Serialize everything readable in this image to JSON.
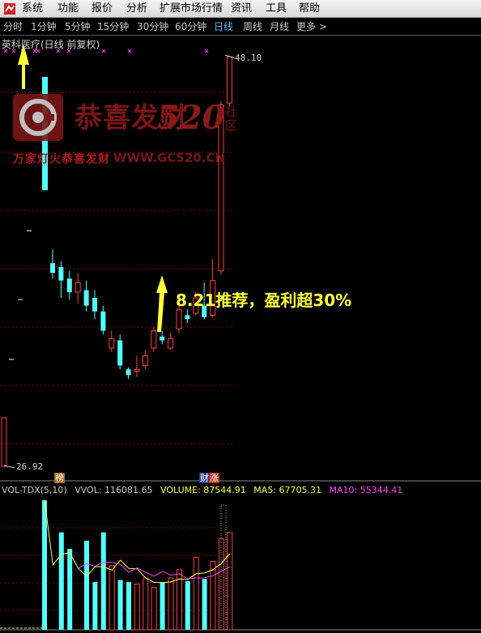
{
  "menu": {
    "items": [
      "系统",
      "功能",
      "报价",
      "分析",
      "扩展市场行情",
      "资讯",
      "工具",
      "帮助"
    ]
  },
  "periods": {
    "items": [
      "分时",
      "1分钟",
      "5分钟",
      "15分钟",
      "30分钟",
      "60分钟",
      "日线",
      "周线",
      "月线",
      "更多 >"
    ],
    "active": "日线"
  },
  "chart_title": "英科医疗(日线 前复权)",
  "price_high_label": "48.10",
  "price_low_label": "26.92",
  "annotation": "8.21推荐，盈利超30%",
  "tags": {
    "bang": "榜",
    "cai": "财",
    "zhang": "涨"
  },
  "watermark": {
    "brand": "恭喜发财",
    "number": "520",
    "she_qu": "社区",
    "slogan": "万家灯火恭喜发财",
    "url": "WWW.GC520.CN"
  },
  "volume_header": {
    "indicator": "VOL-TDX(5,10)",
    "vvol": "VVOL: 116081.65",
    "volume": "VOLUME: 87544.91",
    "ma5": "MA5: 67705.31",
    "ma10": "MA10: 55344.41"
  },
  "colors": {
    "up": "#ff4040",
    "down": "#54ffff",
    "ma5": "#ffff40",
    "ma10": "#ff40ff",
    "grid": "#8b0000",
    "annotation": "#ffff3c"
  },
  "chart_data": {
    "type": "candlestick",
    "price_range": [
      26.92,
      48.1
    ],
    "candles": [
      {
        "open": 37.4,
        "close": 36.9,
        "high": 38.1,
        "low": 36.6,
        "dir": "down"
      },
      {
        "open": 37.2,
        "close": 36.5,
        "high": 37.5,
        "low": 35.6,
        "dir": "down"
      },
      {
        "open": 36.6,
        "close": 35.9,
        "high": 37.0,
        "low": 35.5,
        "dir": "down"
      },
      {
        "open": 35.9,
        "close": 36.4,
        "high": 36.9,
        "low": 35.3,
        "dir": "up"
      },
      {
        "open": 36.0,
        "close": 35.2,
        "high": 36.5,
        "low": 34.9,
        "dir": "down"
      },
      {
        "open": 35.6,
        "close": 34.9,
        "high": 36.0,
        "low": 34.5,
        "dir": "down"
      },
      {
        "open": 34.9,
        "close": 33.9,
        "high": 35.2,
        "low": 33.7,
        "dir": "down"
      },
      {
        "open": 33.0,
        "close": 33.5,
        "high": 33.9,
        "low": 32.8,
        "dir": "up"
      },
      {
        "open": 33.4,
        "close": 32.1,
        "high": 33.7,
        "low": 31.9,
        "dir": "down"
      },
      {
        "open": 31.9,
        "close": 31.6,
        "high": 32.0,
        "low": 31.4,
        "dir": "down"
      },
      {
        "open": 31.8,
        "close": 31.9,
        "high": 32.6,
        "low": 31.5,
        "dir": "up"
      },
      {
        "open": 32.1,
        "close": 32.6,
        "high": 32.9,
        "low": 31.9,
        "dir": "up"
      },
      {
        "open": 33.0,
        "close": 33.9,
        "high": 34.1,
        "low": 32.8,
        "dir": "up"
      },
      {
        "open": 33.6,
        "close": 33.4,
        "high": 33.9,
        "low": 33.2,
        "dir": "down"
      },
      {
        "open": 33.0,
        "close": 33.5,
        "high": 33.8,
        "low": 32.9,
        "dir": "up"
      },
      {
        "open": 34.0,
        "close": 35.0,
        "high": 35.2,
        "low": 33.8,
        "dir": "up"
      },
      {
        "open": 34.7,
        "close": 34.5,
        "high": 35.0,
        "low": 34.3,
        "dir": "down"
      },
      {
        "open": 34.8,
        "close": 35.6,
        "high": 35.9,
        "low": 34.7,
        "dir": "up"
      },
      {
        "open": 35.2,
        "close": 34.6,
        "high": 36.4,
        "low": 34.5,
        "dir": "down"
      },
      {
        "open": 34.7,
        "close": 36.5,
        "high": 37.6,
        "low": 34.6,
        "dir": "up"
      },
      {
        "open": 37.0,
        "close": 45.6,
        "high": 45.8,
        "low": 36.8,
        "dir": "up"
      },
      {
        "open": 45.7,
        "close": 48.1,
        "high": 48.1,
        "low": 45.5,
        "dir": "up"
      }
    ],
    "volume": {
      "indicator": "VOL-TDX(5,10)",
      "values": [
        125,
        0,
        94,
        78,
        0,
        86,
        46,
        94,
        62,
        48,
        46,
        44,
        50,
        41,
        46,
        50,
        58,
        47,
        70,
        49,
        66,
        88,
        94
      ]
    }
  }
}
